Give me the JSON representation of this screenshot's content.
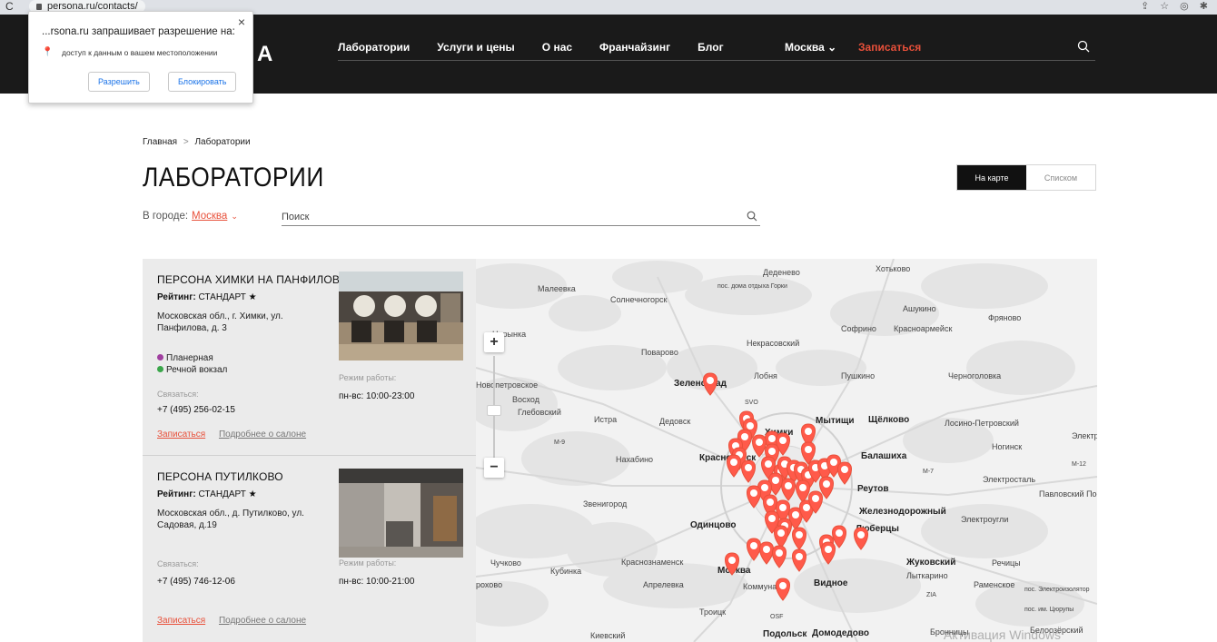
{
  "browser": {
    "url": "persona.ru/contacts/"
  },
  "permission": {
    "title": "...rsona.ru запрашивает разрешение на:",
    "description": "доступ к данным о вашем местоположении",
    "allow": "Разрешить",
    "block": "Блокировать",
    "close": "×"
  },
  "header": {
    "logo_fragment": "A",
    "nav": [
      "Лаборатории",
      "Услуги и цены",
      "О нас",
      "Франчайзинг",
      "Блог"
    ],
    "city": "Москва",
    "signup": "Записаться"
  },
  "breadcrumb": {
    "home": "Главная",
    "sep": ">",
    "current": "Лаборатории"
  },
  "page": {
    "title": "ЛАБОРАТОРИИ",
    "view_map": "На карте",
    "view_list": "Списком"
  },
  "filter": {
    "city_label": "В городе:",
    "city_value": "Москва",
    "search_placeholder": "Поиск"
  },
  "cards": [
    {
      "name": "ПЕРСОНА ХИМКИ НА ПАНФИЛОВА",
      "rating_label": "Рейтинг:",
      "rating_value": "СТАНДАРТ ★",
      "address": "Московская обл., г. Химки, ул. Панфилова, д. 3",
      "metro": [
        {
          "name": "Планерная",
          "color": "#a040a0"
        },
        {
          "name": "Речной вокзал",
          "color": "#3aa64a"
        }
      ],
      "contact_label": "Связаться:",
      "phone": "+7 (495) 256-02-15",
      "hours_label": "Режим работы:",
      "hours": "пн-вс: 10:00-23:00",
      "signup": "Записаться",
      "more": "Подробнее о салоне"
    },
    {
      "name": "ПЕРСОНА ПУТИЛКОВО",
      "rating_label": "Рейтинг:",
      "rating_value": "СТАНДАРТ ★",
      "address": "Московская обл., д. Путилково, ул. Садовая, д.19",
      "metro": [],
      "contact_label": "Связаться:",
      "phone": "+7 (495) 746-12-06",
      "hours_label": "Режим работы:",
      "hours": "пн-вс: 10:00-21:00",
      "signup": "Записаться",
      "more": "Подробнее о салоне"
    }
  ],
  "map": {
    "labels": [
      "Деденево",
      "Хотьково",
      "Малеевка",
      "пос. дома отдыха Горки",
      "Солнечногорск",
      "Ашукино",
      "Нарынка",
      "Софрино",
      "Красноармейск",
      "Фряново",
      "Поварово",
      "Некрасовский",
      "Новопетровское",
      "Зеленоград",
      "Лобня",
      "Пушкино",
      "Черноголовка",
      "Восход",
      "SVO",
      "Глебовский",
      "Истра",
      "Мытищи",
      "Щёлково",
      "Лосино-Петровский",
      "Химки",
      "Дедовск",
      "Красногорск",
      "Нахабино",
      "Ногинск",
      "Электр",
      "Балашиха",
      "Реутов",
      "Электросталь",
      "Звенигород",
      "Павловский Посад",
      "Железнодорожный",
      "Электроугли",
      "Одинцово",
      "Люберцы",
      "Чучково",
      "Кубинка",
      "Краснознаменск",
      "Москва",
      "Жуковский",
      "Речицы",
      "Апрелевка",
      "Коммунарка",
      "Видное",
      "Лыткарино",
      "Раменское",
      "ZIA",
      "пос. Электроизолятор",
      "роховo",
      "Троицк",
      "OSF",
      "пос. им. Цюрупы",
      "Белоозёрский",
      "Киевский",
      "Подольск",
      "Домодедово",
      "Бронницы",
      "M-9",
      "M-7",
      "M-12"
    ],
    "watermark": "Активация Windows",
    "zoom_in": "+",
    "zoom_out": "−"
  }
}
